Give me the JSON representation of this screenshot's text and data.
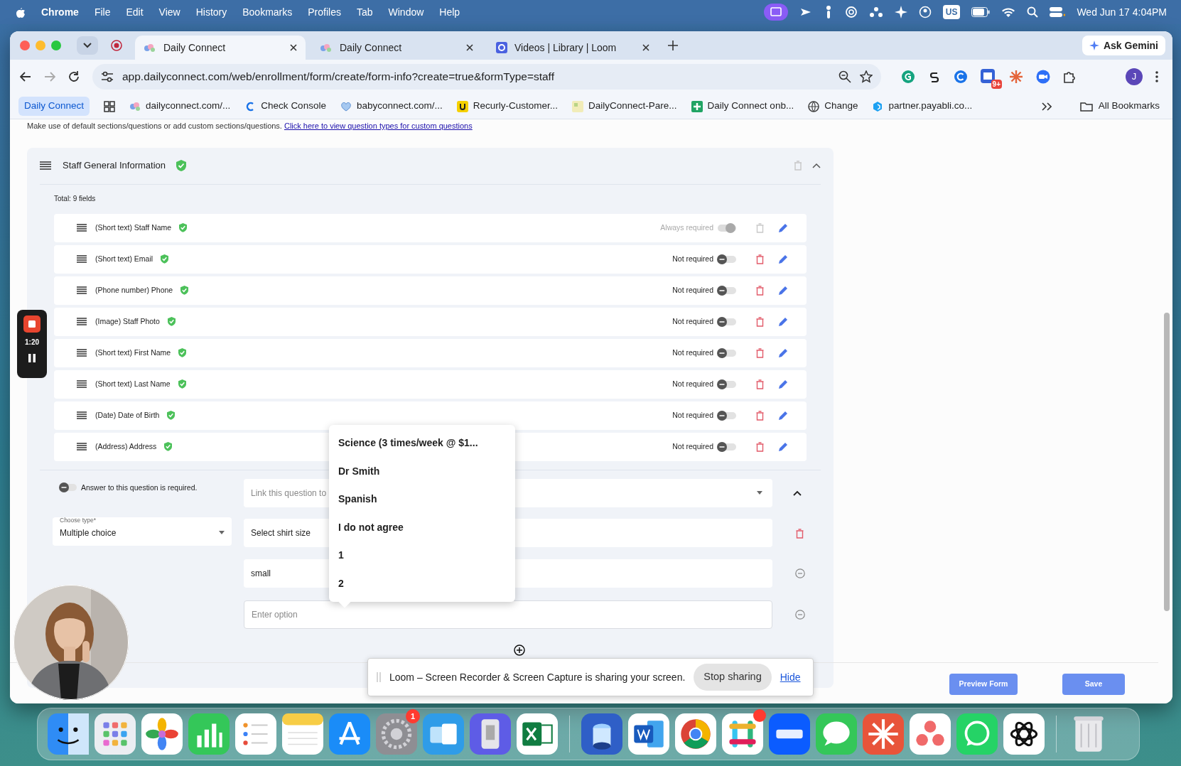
{
  "menu_bar": {
    "app": "Chrome",
    "items": [
      "File",
      "Edit",
      "View",
      "History",
      "Bookmarks",
      "Profiles",
      "Tab",
      "Window",
      "Help"
    ],
    "input_source": "US",
    "clock": "Wed Jun 17  4:04PM"
  },
  "browser": {
    "tabs": [
      {
        "title": "Daily Connect",
        "selected": true
      },
      {
        "title": "Daily Connect",
        "selected": false
      },
      {
        "title": "Videos | Library | Loom",
        "selected": false
      }
    ],
    "gemini": "Ask Gemini",
    "url": "app.dailyconnect.com/web/enrollment/form/create/form-info?create=true&formType=staff",
    "extension_badge": "9+",
    "profile_initial": "J",
    "bookmarks": [
      {
        "label": "Daily Connect",
        "kind": "pill"
      },
      {
        "label": "dailyconnect.com/...",
        "kind": "link"
      },
      {
        "label": "Check Console",
        "kind": "link"
      },
      {
        "label": "babyconnect.com/...",
        "kind": "link"
      },
      {
        "label": "Recurly-Customer...",
        "kind": "link"
      },
      {
        "label": "DailyConnect-Pare...",
        "kind": "link"
      },
      {
        "label": "Daily Connect onb...",
        "kind": "link"
      },
      {
        "label": "Change",
        "kind": "link"
      },
      {
        "label": "partner.payabli.co...",
        "kind": "link"
      }
    ],
    "all_bookmarks": "All Bookmarks"
  },
  "page": {
    "intro": "Make use of default sections/questions or add custom sections/questions.",
    "intro_link": "Click here to view question types for custom questions",
    "section": {
      "title": "Staff General Information",
      "total": "Total: 9 fields",
      "fields": [
        {
          "label": "(Short text) Staff Name",
          "required_text": "Always required",
          "required": true,
          "locked": true
        },
        {
          "label": "(Short text) Email",
          "required_text": "Not required",
          "required": false,
          "locked": false
        },
        {
          "label": "(Phone number) Phone",
          "required_text": "Not required",
          "required": false,
          "locked": false
        },
        {
          "label": "(Image) Staff Photo",
          "required_text": "Not required",
          "required": false,
          "locked": false
        },
        {
          "label": "(Short text) First Name",
          "required_text": "Not required",
          "required": false,
          "locked": false
        },
        {
          "label": "(Short text) Last Name",
          "required_text": "Not required",
          "required": false,
          "locked": false
        },
        {
          "label": "(Date) Date of Birth",
          "required_text": "Not required",
          "required": false,
          "locked": false
        },
        {
          "label": "(Address) Address",
          "required_text": "Not required",
          "required": false,
          "locked": false
        }
      ]
    },
    "question": {
      "required_label": "Answer to this question is required.",
      "required": false,
      "type_label": "Choose type*",
      "type_value": "Multiple choice",
      "link_placeholder": "Link this question to",
      "question_text": "Select shirt size",
      "options": [
        "small"
      ],
      "new_option_placeholder": "Enter option"
    },
    "dropdown": [
      "Science (3 times/week @ $1...",
      "Dr Smith",
      "Spanish",
      "I do not agree",
      "1",
      "2"
    ],
    "preview_button": "Preview Form",
    "save_button": "Save"
  },
  "loom": {
    "timer": "1:20",
    "share_message": "Loom – Screen Recorder & Screen Capture is sharing your screen.",
    "stop": "Stop sharing",
    "hide": "Hide"
  },
  "dock": {
    "badge": "1"
  }
}
